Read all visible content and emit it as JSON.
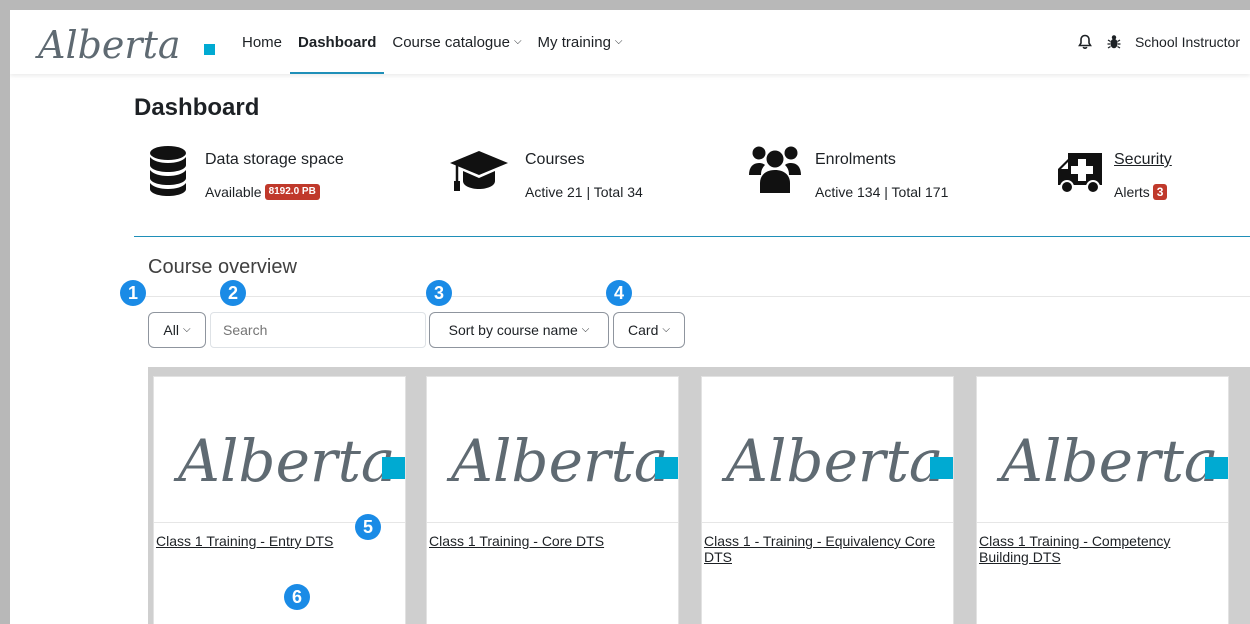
{
  "navbar": {
    "links": [
      {
        "label": "Home"
      },
      {
        "label": "Dashboard"
      },
      {
        "label": "Course catalogue"
      },
      {
        "label": "My training"
      }
    ],
    "user_name": "School Instructor"
  },
  "page_title": "Dashboard",
  "stats": {
    "storage": {
      "label": "Data storage space",
      "sub_prefix": "Available",
      "badge": "8192.0 PB"
    },
    "courses": {
      "label": "Courses",
      "sub": "Active 21 | Total 34"
    },
    "enrolments": {
      "label": "Enrolments",
      "sub": "Active 134 | Total 171"
    },
    "security": {
      "label": "Security",
      "sub_prefix": "Alerts",
      "badge": "3"
    }
  },
  "overview": {
    "title": "Course overview",
    "filter_label": "All",
    "search_placeholder": "Search",
    "sort_label": "Sort by course name",
    "view_label": "Card"
  },
  "markers": [
    "1",
    "2",
    "3",
    "4",
    "5",
    "6"
  ],
  "courses": [
    {
      "name": "Class 1 Training - Entry DTS"
    },
    {
      "name": "Class 1 Training - Core DTS"
    },
    {
      "name": "Class 1 - Training - Equivalency Core DTS"
    },
    {
      "name": "Class 1 Training - Competency Building DTS"
    }
  ],
  "colors": {
    "accent": "#1f8fb8",
    "badge": "#c0392b",
    "marker": "#1a8be6",
    "logo_blue": "#00aad2",
    "logo_gray": "#5f6a72"
  },
  "icons": [
    "bell-icon",
    "bug-icon",
    "database-icon",
    "graduation-cap-icon",
    "users-icon",
    "ambulance-icon",
    "chevron-down-icon"
  ]
}
